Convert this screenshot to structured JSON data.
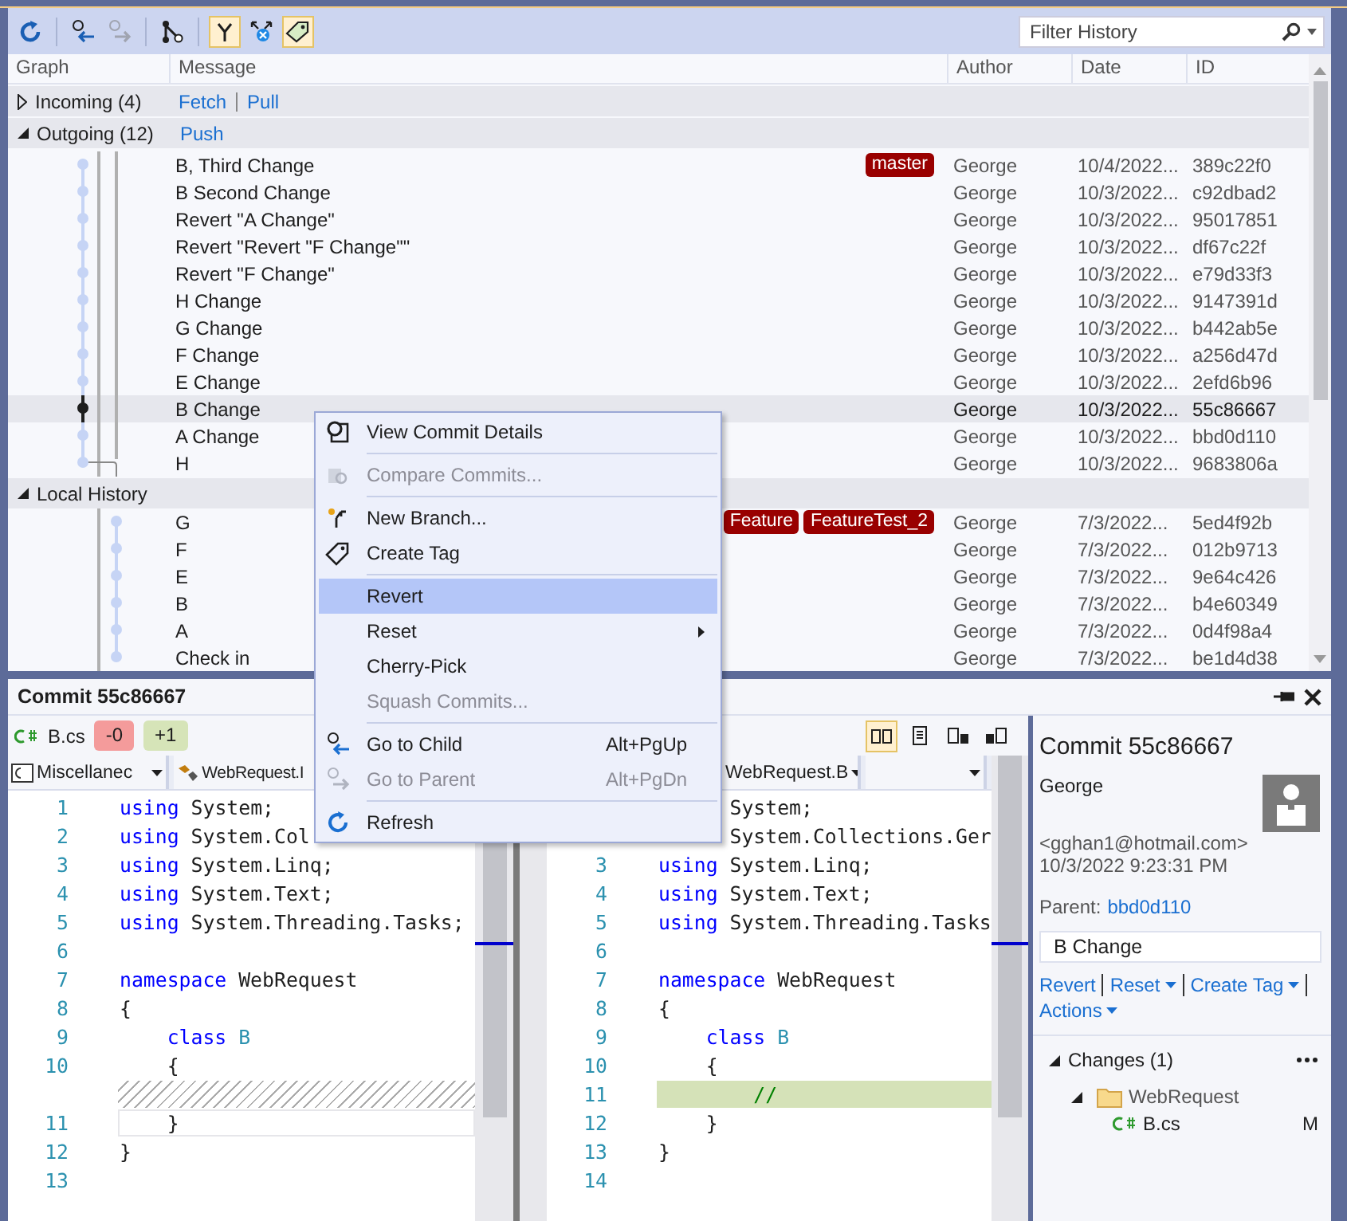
{
  "toolbar": {
    "toggles": [
      {
        "kind": "branches",
        "on": true
      },
      {
        "kind": "remote",
        "on": false
      },
      {
        "kind": "tags",
        "on": true
      }
    ],
    "filter": {
      "placeholder": "Filter History"
    }
  },
  "columns": [
    "Graph",
    "Message",
    "Author",
    "Date",
    "ID"
  ],
  "groups": [
    {
      "kind": "incoming",
      "title": "Incoming (4)",
      "expanded": false,
      "links": [
        "Fetch",
        "Pull"
      ]
    },
    {
      "kind": "outgoing",
      "title": "Outgoing (12)",
      "expanded": true,
      "links": [
        "Push"
      ],
      "rows": [
        {
          "message": "B, Third Change",
          "tags": [
            "master"
          ],
          "author": "George",
          "date": "10/4/2022...",
          "id": "389c22f0",
          "selected": false
        },
        {
          "message": "B Second Change",
          "author": "George",
          "date": "10/3/2022...",
          "id": "c92dbad2",
          "selected": false
        },
        {
          "message": "Revert \"A Change\"",
          "author": "George",
          "date": "10/3/2022...",
          "id": "95017851",
          "selected": false
        },
        {
          "message": "Revert \"Revert \"F Change\"\"",
          "author": "George",
          "date": "10/3/2022...",
          "id": "df67c22f",
          "selected": false
        },
        {
          "message": "Revert \"F Change\"",
          "author": "George",
          "date": "10/3/2022...",
          "id": "e79d33f3",
          "selected": false
        },
        {
          "message": "H Change",
          "author": "George",
          "date": "10/3/2022...",
          "id": "9147391d",
          "selected": false
        },
        {
          "message": "G Change",
          "author": "George",
          "date": "10/3/2022...",
          "id": "b442ab5e",
          "selected": false
        },
        {
          "message": "F Change",
          "author": "George",
          "date": "10/3/2022...",
          "id": "a256d47d",
          "selected": false
        },
        {
          "message": "E Change",
          "author": "George",
          "date": "10/3/2022...",
          "id": "2efd6b96",
          "selected": false
        },
        {
          "message": "B Change",
          "author": "George",
          "date": "10/3/2022...",
          "id": "55c86667",
          "selected": true
        },
        {
          "message": "A Change",
          "author": "George",
          "date": "10/3/2022...",
          "id": "bbd0d110",
          "selected": false
        },
        {
          "message": "H",
          "author": "George",
          "date": "10/3/2022...",
          "id": "9683806a",
          "selected": false
        }
      ]
    },
    {
      "kind": "local",
      "title": "Local History",
      "expanded": true,
      "rows": [
        {
          "message": "G",
          "tags": [
            "Feature",
            "FeatureTest_2"
          ],
          "author": "George",
          "date": "7/3/2022...",
          "id": "5ed4f92b",
          "selected": false
        },
        {
          "message": "F",
          "author": "George",
          "date": "7/3/2022...",
          "id": "012b9713",
          "selected": false
        },
        {
          "message": "E",
          "author": "George",
          "date": "7/3/2022...",
          "id": "9e64c426",
          "selected": false
        },
        {
          "message": "B",
          "author": "George",
          "date": "7/3/2022...",
          "id": "b4e60349",
          "selected": false
        },
        {
          "message": "A",
          "author": "George",
          "date": "7/3/2022...",
          "id": "0d4f98a4",
          "selected": false
        },
        {
          "message": "Check in",
          "author": "George",
          "date": "7/3/2022...",
          "id": "be1d4d38",
          "selected": false
        }
      ]
    }
  ],
  "context_menu": [
    {
      "kind": "item",
      "label": "View Commit Details",
      "disabled": false,
      "selected": false
    },
    {
      "kind": "separator"
    },
    {
      "kind": "item",
      "label": "Compare Commits...",
      "disabled": true,
      "selected": false
    },
    {
      "kind": "separator"
    },
    {
      "kind": "item",
      "label": "New Branch...",
      "disabled": false,
      "selected": false
    },
    {
      "kind": "item",
      "label": "Create Tag",
      "disabled": false,
      "selected": false
    },
    {
      "kind": "separator"
    },
    {
      "kind": "item",
      "label": "Revert",
      "disabled": false,
      "selected": true
    },
    {
      "kind": "item",
      "label": "Reset",
      "disabled": false,
      "selected": false,
      "submenu": true
    },
    {
      "kind": "item",
      "label": "Cherry-Pick",
      "disabled": false,
      "selected": false
    },
    {
      "kind": "item",
      "label": "Squash Commits...",
      "disabled": true,
      "selected": false
    },
    {
      "kind": "separator"
    },
    {
      "kind": "item",
      "label": "Go to Child",
      "shortcut": "Alt+PgUp",
      "disabled": false,
      "selected": false
    },
    {
      "kind": "item",
      "label": "Go to Parent",
      "shortcut": "Alt+PgDn",
      "disabled": true,
      "selected": false
    },
    {
      "kind": "separator"
    },
    {
      "kind": "item",
      "label": "Refresh",
      "disabled": false,
      "selected": false
    }
  ],
  "commit_panel": {
    "title": "Commit 55c86667",
    "file_bar": {
      "file": "B.cs",
      "removed": "-0",
      "added": "+1",
      "view_modes": [
        {
          "selected": true
        },
        {
          "selected": false
        },
        {
          "selected": false
        },
        {
          "selected": false
        }
      ]
    },
    "left_diff": {
      "dropdowns": [
        "Miscellanec",
        "WebRequest.I"
      ],
      "lines": [
        {
          "kind": "normal",
          "number": "1",
          "tokens": [
            {
              "kind": "keyword",
              "text": "using"
            },
            {
              "kind": "plain",
              "text": " System;"
            }
          ]
        },
        {
          "kind": "normal",
          "number": "2",
          "tokens": [
            {
              "kind": "keyword",
              "text": "using"
            },
            {
              "kind": "plain",
              "text": " System.Col"
            }
          ]
        },
        {
          "kind": "normal",
          "number": "3",
          "tokens": [
            {
              "kind": "keyword",
              "text": "using"
            },
            {
              "kind": "plain",
              "text": " System.Linq;"
            }
          ]
        },
        {
          "kind": "normal",
          "number": "4",
          "tokens": [
            {
              "kind": "keyword",
              "text": "using"
            },
            {
              "kind": "plain",
              "text": " System.Text;"
            }
          ]
        },
        {
          "kind": "normal",
          "number": "5",
          "tokens": [
            {
              "kind": "keyword",
              "text": "using"
            },
            {
              "kind": "plain",
              "text": " System.Threading.Tasks;"
            }
          ]
        },
        {
          "kind": "normal",
          "number": "6"
        },
        {
          "kind": "normal",
          "number": "7",
          "tokens": [
            {
              "kind": "keyword",
              "text": "namespace"
            },
            {
              "kind": "plain",
              "text": " WebRequest"
            }
          ]
        },
        {
          "kind": "normal",
          "number": "8",
          "tokens": [
            {
              "kind": "plain",
              "text": "{"
            }
          ]
        },
        {
          "kind": "normal",
          "number": "9",
          "tokens": [
            {
              "kind": "keyword",
              "text": "    class"
            },
            {
              "kind": "type",
              "text": " B"
            }
          ]
        },
        {
          "kind": "normal",
          "number": "10",
          "tokens": [
            {
              "kind": "plain",
              "text": "    {"
            }
          ]
        },
        {
          "kind": "missing"
        },
        {
          "kind": "changed",
          "number": "11",
          "tokens": [
            {
              "kind": "plain",
              "text": "    }"
            }
          ]
        },
        {
          "kind": "normal",
          "number": "12",
          "tokens": [
            {
              "kind": "plain",
              "text": "}"
            }
          ]
        },
        {
          "kind": "normal",
          "number": "13"
        }
      ]
    },
    "right_diff": {
      "dropdowns": [
        "WebRequest.B"
      ],
      "lines": [
        {
          "kind": "normal",
          "tokens": [
            {
              "kind": "plain",
              "text": "      System;"
            }
          ]
        },
        {
          "kind": "normal",
          "tokens": [
            {
              "kind": "plain",
              "text": "      System.Collections.Ger"
            }
          ]
        },
        {
          "kind": "normal",
          "number": "3",
          "tokens": [
            {
              "kind": "keyword",
              "text": "using"
            },
            {
              "kind": "plain",
              "text": " System.Linq;"
            }
          ]
        },
        {
          "kind": "normal",
          "number": "4",
          "tokens": [
            {
              "kind": "keyword",
              "text": "using"
            },
            {
              "kind": "plain",
              "text": " System.Text;"
            }
          ]
        },
        {
          "kind": "normal",
          "number": "5",
          "tokens": [
            {
              "kind": "keyword",
              "text": "using"
            },
            {
              "kind": "plain",
              "text": " System.Threading.Tasks"
            }
          ]
        },
        {
          "kind": "normal",
          "number": "6"
        },
        {
          "kind": "normal",
          "number": "7",
          "tokens": [
            {
              "kind": "keyword",
              "text": "namespace"
            },
            {
              "kind": "plain",
              "text": " WebRequest"
            }
          ]
        },
        {
          "kind": "normal",
          "number": "8",
          "tokens": [
            {
              "kind": "plain",
              "text": "{"
            }
          ]
        },
        {
          "kind": "normal",
          "number": "9",
          "tokens": [
            {
              "kind": "keyword",
              "text": "    class"
            },
            {
              "kind": "type",
              "text": " B"
            }
          ]
        },
        {
          "kind": "normal",
          "number": "10",
          "tokens": [
            {
              "kind": "plain",
              "text": "    {"
            }
          ]
        },
        {
          "kind": "added",
          "number": "11",
          "tokens": [
            {
              "kind": "comment",
              "text": "        //"
            }
          ]
        },
        {
          "kind": "normal",
          "number": "12",
          "tokens": [
            {
              "kind": "plain",
              "text": "    }"
            }
          ]
        },
        {
          "kind": "normal",
          "number": "13",
          "tokens": [
            {
              "kind": "plain",
              "text": "}"
            }
          ]
        },
        {
          "kind": "normal",
          "number": "14"
        }
      ]
    },
    "details": {
      "title": "Commit 55c86667",
      "author": "George",
      "email": "<gghan1@hotmail.com>",
      "date": "10/3/2022 9:23:31 PM",
      "parent_label": "Parent:",
      "parent": "bbd0d110",
      "message": "B Change",
      "actions": [
        {
          "label": "Revert",
          "dropdown": false
        },
        {
          "label": "Reset",
          "dropdown": true
        },
        {
          "label": "Create Tag",
          "dropdown": true
        },
        {
          "label": "Actions",
          "dropdown": true
        }
      ],
      "changes": {
        "title": "Changes (1)",
        "expanded": true,
        "tree": [
          {
            "name": "WebRequest",
            "expanded": true,
            "children": [
              {
                "name": "B.cs",
                "status": "M"
              }
            ]
          }
        ]
      }
    }
  }
}
